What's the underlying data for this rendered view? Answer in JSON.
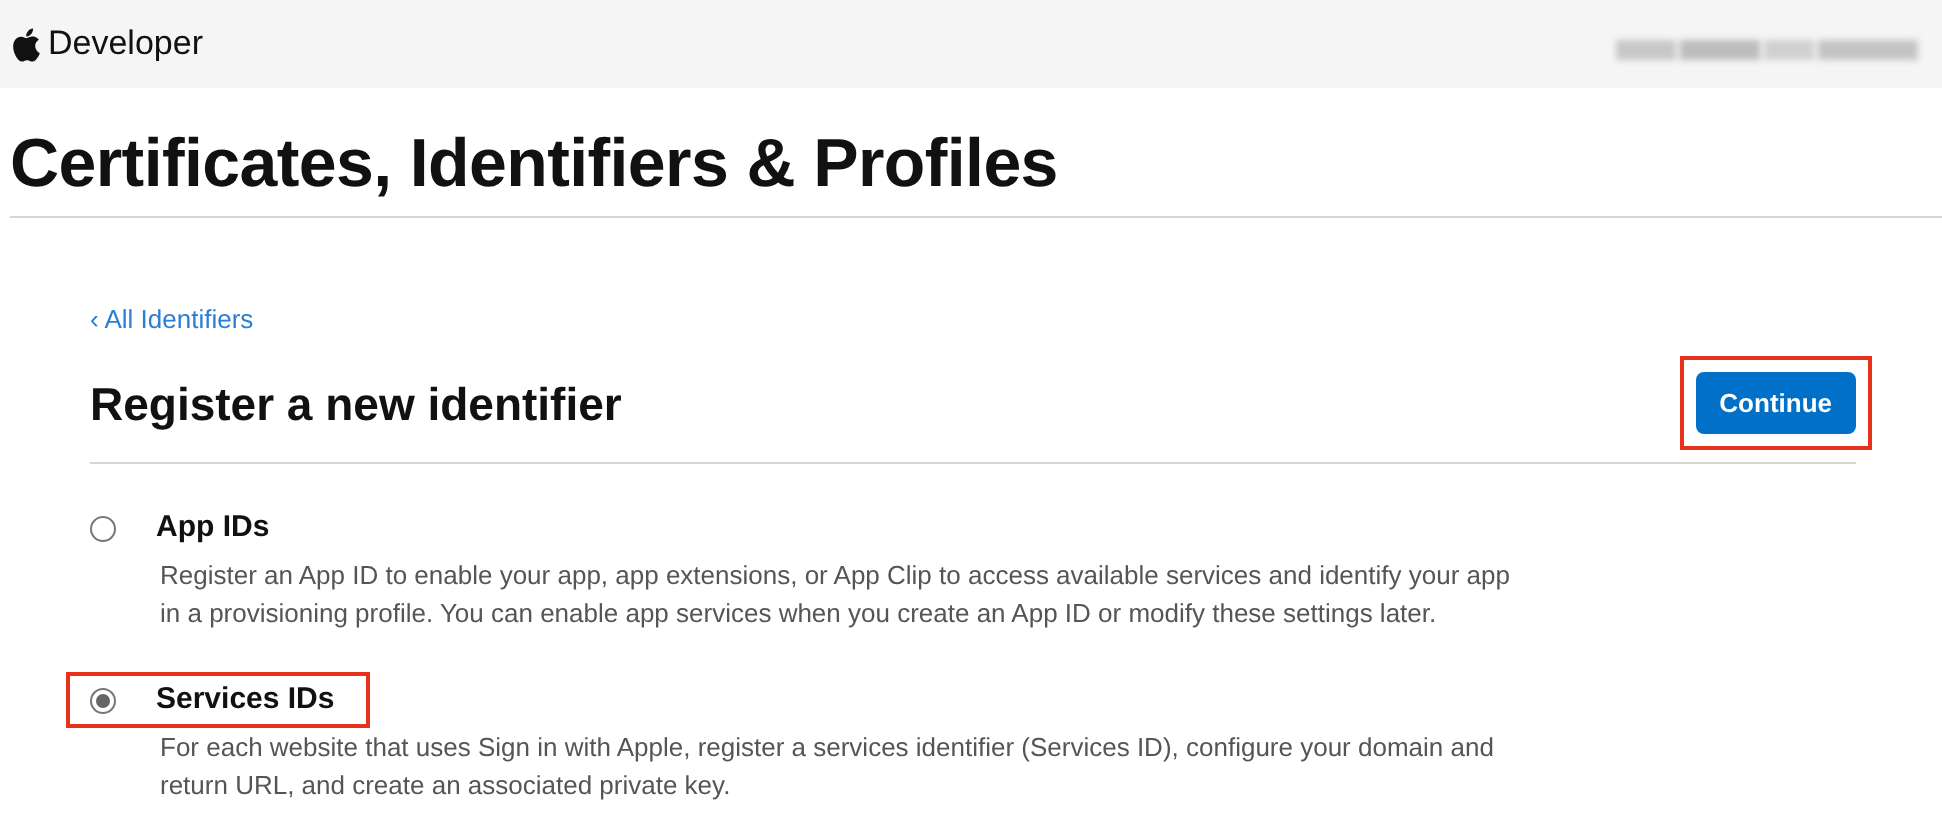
{
  "header": {
    "brand": "Developer"
  },
  "page_title": "Certificates, Identifiers & Profiles",
  "back_link": "‹ All Identifiers",
  "section_title": "Register a new identifier",
  "continue_button": {
    "label": "Continue",
    "highlighted": true
  },
  "options": [
    {
      "label": "App IDs",
      "description": "Register an App ID to enable your app, app extensions, or App Clip to access available services and identify your app in a provisioning profile. You can enable app services when you create an App ID or modify these settings later.",
      "selected": false,
      "highlighted": false
    },
    {
      "label": "Services IDs",
      "description": "For each website that uses Sign in with Apple, register a services identifier (Services ID), configure your domain and return URL, and create an associated private key.",
      "selected": true,
      "highlighted": true
    }
  ]
}
